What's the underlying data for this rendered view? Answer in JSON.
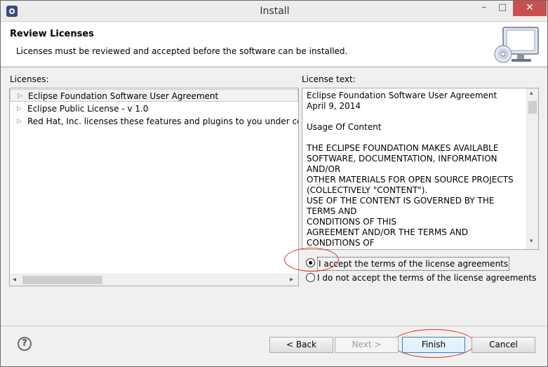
{
  "window": {
    "title": "Install",
    "minimize_glyph": "–",
    "maximize_glyph": "□",
    "close_glyph": "✕"
  },
  "banner": {
    "title": "Review Licenses",
    "description": "Licenses must be reviewed and accepted before the software can be installed."
  },
  "licenses_panel": {
    "label": "Licenses:",
    "items": [
      {
        "label": "Eclipse Foundation Software User Agreement"
      },
      {
        "label": "Eclipse Public License - v 1.0"
      },
      {
        "label": "Red Hat, Inc. licenses these features and plugins to you under certain open source licenses"
      }
    ]
  },
  "license_text_panel": {
    "label": "License text:",
    "text": "Eclipse Foundation Software User Agreement\nApril 9, 2014\n\nUsage Of Content\n\nTHE ECLIPSE FOUNDATION MAKES AVAILABLE\nSOFTWARE, DOCUMENTATION, INFORMATION AND/OR\nOTHER MATERIALS FOR OPEN SOURCE PROJECTS\n(COLLECTIVELY \"CONTENT\").\nUSE OF THE CONTENT IS GOVERNED BY THE TERMS AND\nCONDITIONS OF THIS\nAGREEMENT AND/OR THE TERMS AND CONDITIONS OF\nLICENSE AGREEMENTS OR\nNOTICES INDICATED OR REFERENCED BELOW.  BY USING\nTHE CONTENT, YOU"
  },
  "agreement": {
    "accept_label": "I accept the terms of the license agreements",
    "decline_label": "I do not accept the terms of the license agreements",
    "selected": "accept"
  },
  "buttons": {
    "back": "< Back",
    "next": "Next >",
    "finish": "Finish",
    "cancel": "Cancel"
  },
  "icons": {
    "help": "?",
    "tree_expand": "▷",
    "scroll_left": "◂",
    "scroll_right": "▸",
    "scroll_up": "▴",
    "scroll_down": "▾"
  },
  "colors": {
    "annotation": "#d32f2f",
    "close_button": "#c75050",
    "default_button_border": "#3c7fb1"
  }
}
